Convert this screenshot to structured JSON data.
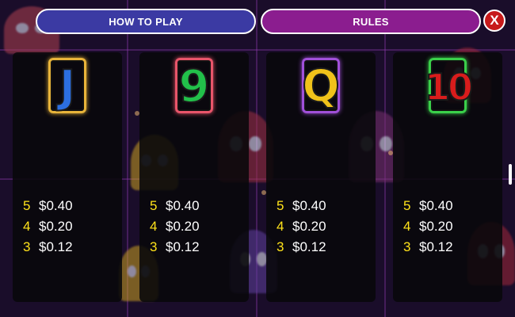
{
  "header": {
    "how_to_play_label": "HOW TO PLAY",
    "rules_label": "RULES",
    "close_label": "X"
  },
  "colors": {
    "how_to_play_bg": "#3b3aa3",
    "rules_bg": "#8b1d8f",
    "close_bg": "#c71a1a",
    "count_color": "#ffe21a",
    "amount_color": "#ffffff"
  },
  "panels": [
    {
      "symbol": {
        "icon": "j-symbol-icon",
        "glyph": "J",
        "fill": "#2c6fe0",
        "frame": "#e8b43a"
      },
      "pays": [
        {
          "count": "5",
          "amount": "$0.40"
        },
        {
          "count": "4",
          "amount": "$0.20"
        },
        {
          "count": "3",
          "amount": "$0.12"
        }
      ]
    },
    {
      "symbol": {
        "icon": "nine-symbol-icon",
        "glyph": "9",
        "fill": "#22c04a",
        "frame": "#e8556a"
      },
      "pays": [
        {
          "count": "5",
          "amount": "$0.40"
        },
        {
          "count": "4",
          "amount": "$0.20"
        },
        {
          "count": "3",
          "amount": "$0.12"
        }
      ]
    },
    {
      "symbol": {
        "icon": "q-symbol-icon",
        "glyph": "Q",
        "fill": "#f0c21a",
        "frame": "#a050d8"
      },
      "pays": [
        {
          "count": "5",
          "amount": "$0.40"
        },
        {
          "count": "4",
          "amount": "$0.20"
        },
        {
          "count": "3",
          "amount": "$0.12"
        }
      ]
    },
    {
      "symbol": {
        "icon": "ten-symbol-icon",
        "glyph": "10",
        "fill": "#d81c1c",
        "frame": "#3ad04a"
      },
      "pays": [
        {
          "count": "5",
          "amount": "$0.40"
        },
        {
          "count": "4",
          "amount": "$0.20"
        },
        {
          "count": "3",
          "amount": "$0.12"
        }
      ]
    }
  ]
}
